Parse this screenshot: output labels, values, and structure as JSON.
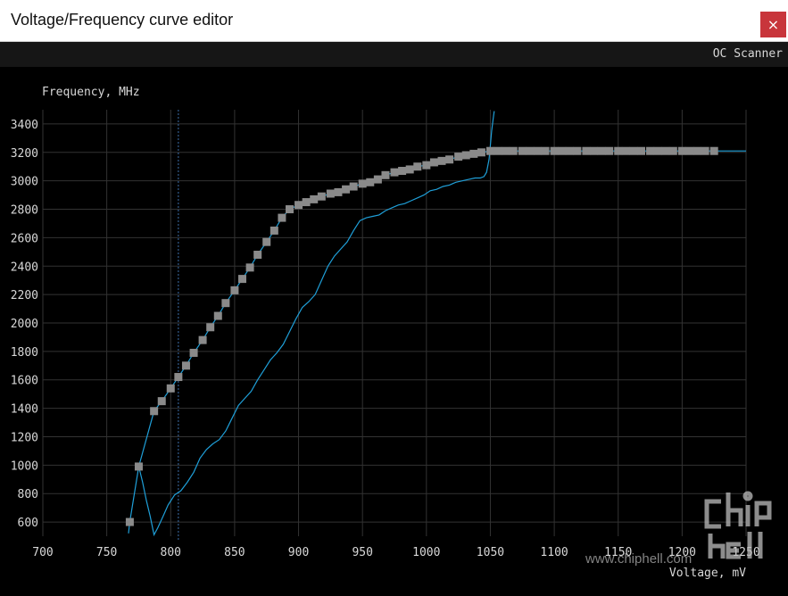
{
  "window": {
    "title": "Voltage/Frequency curve editor",
    "close_label": "×"
  },
  "toolbar": {
    "oc_scanner_label": "OC Scanner"
  },
  "watermark": {
    "text": "www.chiphell.com"
  },
  "colors": {
    "curve": "#1f9fd8",
    "point": "#8a8a8a",
    "grid": "#333333",
    "text": "#d8d8d8",
    "marker": "#3d6fa8"
  },
  "chart_data": {
    "type": "line",
    "title": "",
    "ylabel": "Frequency, MHz",
    "xlabel": "Voltage, mV",
    "xlim": [
      700,
      1250
    ],
    "ylim": [
      500,
      3500
    ],
    "xticks": [
      700,
      750,
      800,
      850,
      900,
      950,
      1000,
      1050,
      1100,
      1150,
      1200,
      1250
    ],
    "yticks": [
      600,
      800,
      1000,
      1200,
      1400,
      1600,
      1800,
      2000,
      2200,
      2400,
      2600,
      2800,
      3000,
      3200,
      3400
    ],
    "grid": true,
    "current_voltage_marker": 806,
    "series": [
      {
        "role": "vf-curve",
        "x": [
          768,
          775,
          787,
          793,
          800,
          806,
          812,
          818,
          825,
          831,
          837,
          843,
          850,
          856,
          862,
          868,
          875,
          881,
          887,
          893,
          900,
          906,
          912,
          918,
          925,
          931,
          937,
          943,
          950,
          956,
          962,
          968,
          975,
          981,
          987,
          993,
          1000,
          1006,
          1012,
          1018,
          1025,
          1031,
          1037,
          1043,
          1050,
          1056,
          1062,
          1068,
          1075,
          1081,
          1087,
          1093,
          1100,
          1106,
          1112,
          1118,
          1125,
          1131,
          1137,
          1143,
          1150,
          1156,
          1162,
          1168,
          1175,
          1181,
          1187,
          1193,
          1200,
          1206,
          1212,
          1218,
          1225
        ],
        "y": [
          600,
          990,
          1380,
          1450,
          1540,
          1620,
          1700,
          1790,
          1880,
          1970,
          2050,
          2140,
          2230,
          2310,
          2390,
          2480,
          2570,
          2650,
          2740,
          2800,
          2830,
          2850,
          2870,
          2890,
          2910,
          2920,
          2940,
          2960,
          2980,
          2990,
          3010,
          3040,
          3060,
          3070,
          3080,
          3100,
          3110,
          3130,
          3140,
          3150,
          3170,
          3180,
          3190,
          3200,
          3210,
          3210,
          3210,
          3210,
          3210,
          3210,
          3210,
          3210,
          3210,
          3210,
          3210,
          3210,
          3210,
          3210,
          3210,
          3210,
          3210,
          3210,
          3210,
          3210,
          3210,
          3210,
          3210,
          3210,
          3210,
          3210,
          3210,
          3210,
          3210
        ]
      },
      {
        "role": "monitoring-trace",
        "x": [
          775,
          778,
          781,
          784,
          787,
          790,
          794,
          798,
          803,
          808,
          813,
          818,
          823,
          828,
          833,
          838,
          843,
          848,
          853,
          858,
          863,
          868,
          873,
          878,
          883,
          888,
          893,
          898,
          903,
          908,
          913,
          918,
          923,
          928,
          933,
          938,
          943,
          948,
          953,
          958,
          963,
          968,
          973,
          978,
          983,
          988,
          993,
          998,
          1003,
          1008,
          1013,
          1018,
          1023,
          1028,
          1033,
          1038,
          1042,
          1045,
          1047,
          1049,
          1050,
          1051,
          1052,
          1053
        ],
        "y": [
          990,
          880,
          750,
          640,
          510,
          560,
          640,
          720,
          790,
          820,
          880,
          950,
          1050,
          1110,
          1150,
          1180,
          1240,
          1330,
          1420,
          1470,
          1520,
          1600,
          1670,
          1740,
          1790,
          1850,
          1940,
          2030,
          2110,
          2150,
          2200,
          2300,
          2400,
          2470,
          2520,
          2570,
          2650,
          2720,
          2740,
          2750,
          2760,
          2790,
          2810,
          2830,
          2840,
          2860,
          2880,
          2900,
          2930,
          2940,
          2960,
          2970,
          2990,
          3000,
          3010,
          3020,
          3020,
          3030,
          3060,
          3150,
          3250,
          3350,
          3420,
          3490
        ]
      }
    ]
  }
}
